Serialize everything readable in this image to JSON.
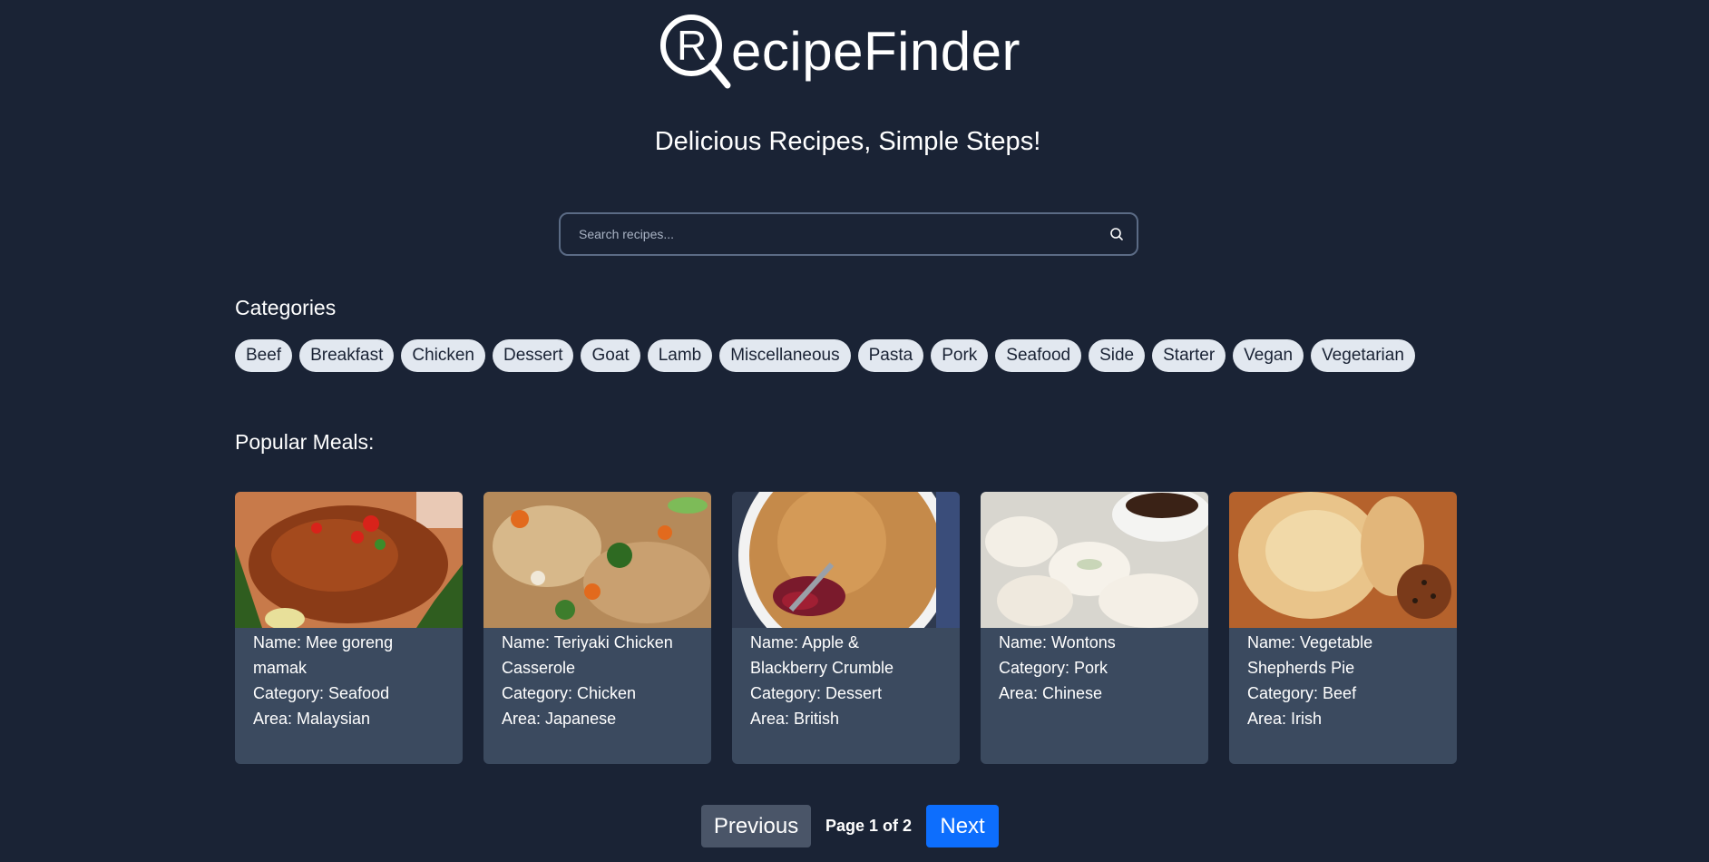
{
  "header": {
    "logo_letter": "R",
    "logo_text": "ecipeFinder",
    "tagline": "Delicious Recipes, Simple Steps!"
  },
  "search": {
    "placeholder": "Search recipes...",
    "value": "",
    "icon": "search-icon"
  },
  "categories": {
    "title": "Categories",
    "items": [
      "Beef",
      "Breakfast",
      "Chicken",
      "Dessert",
      "Goat",
      "Lamb",
      "Miscellaneous",
      "Pasta",
      "Pork",
      "Seafood",
      "Side",
      "Starter",
      "Vegan",
      "Vegetarian"
    ]
  },
  "popular": {
    "title": "Popular Meals:",
    "meals": [
      {
        "name_line1": "Name: Mee goreng",
        "name_line2": "mamak",
        "category": "Category: Seafood",
        "area": "Area: Malaysian",
        "image": "noodle-dish-photo"
      },
      {
        "name_line1": "Name: Teriyaki Chicken",
        "name_line2": "Casserole",
        "category": "Category: Chicken",
        "area": "Area: Japanese",
        "image": "rice-casserole-photo"
      },
      {
        "name_line1": "Name: Apple &",
        "name_line2": "Blackberry Crumble",
        "category": "Category: Dessert",
        "area": "Area: British",
        "image": "crumble-photo"
      },
      {
        "name_line1": "Name: Wontons",
        "name_line2": "",
        "category": "Category: Pork",
        "area": "Area: Chinese",
        "image": "dumplings-photo"
      },
      {
        "name_line1": "Name: Vegetable",
        "name_line2": "Shepherds Pie",
        "category": "Category: Beef",
        "area": "Area: Irish",
        "image": "pie-photo"
      }
    ]
  },
  "pagination": {
    "previous_label": "Previous",
    "page_info": "Page 1 of 2",
    "next_label": "Next"
  },
  "colors": {
    "background": "#1a2335",
    "card": "#3b4a5f",
    "pill": "#e2e8f0",
    "next_button": "#0d6efd",
    "previous_button": "#4a5568"
  }
}
